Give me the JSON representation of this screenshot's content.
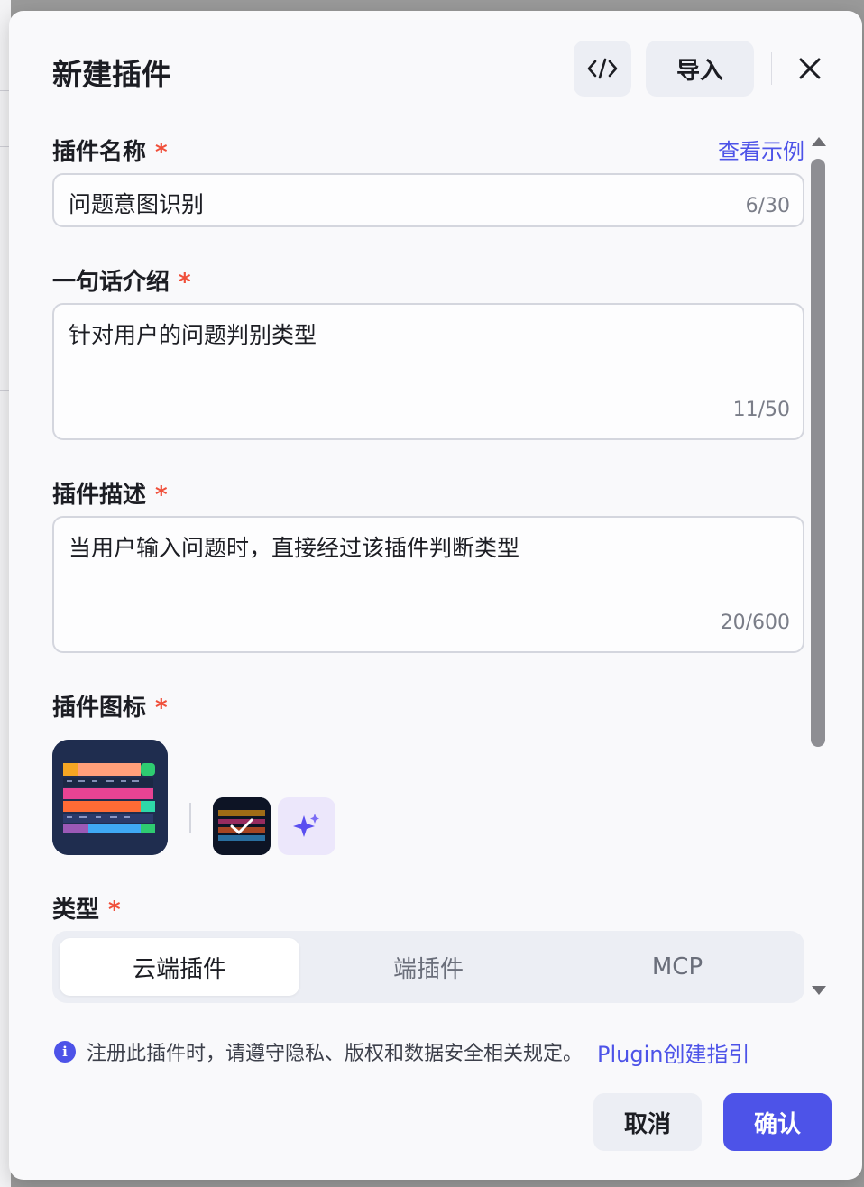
{
  "modal": {
    "title": "新建插件",
    "code_icon": "code-icon",
    "import_label": "导入",
    "close_icon": "close-icon"
  },
  "form": {
    "name": {
      "label": "插件名称",
      "required_mark": "*",
      "example_link": "查看示例",
      "value": "问题意图识别",
      "count": "6/30"
    },
    "intro": {
      "label": "一句话介绍",
      "required_mark": "*",
      "value": "针对用户的问题判别类型",
      "count": "11/50"
    },
    "description": {
      "label": "插件描述",
      "required_mark": "*",
      "value": "当用户输入问题时，直接经过该插件判断类型",
      "count": "20/600"
    },
    "icon": {
      "label": "插件图标",
      "required_mark": "*",
      "ai_generate_icon": "sparkle-icon",
      "selected_icon": "check-icon"
    },
    "type": {
      "label": "类型",
      "required_mark": "*",
      "options": [
        "云端插件",
        "端插件",
        "MCP"
      ],
      "selected": "云端插件"
    }
  },
  "footer": {
    "notice": "注册此插件时，请遵守隐私、版权和数据安全相关规定。",
    "guide_link": "Plugin创建指引",
    "cancel_label": "取消",
    "confirm_label": "确认"
  },
  "colors": {
    "primary": "#4d53e8",
    "required": "#f04f3a",
    "text": "#1c1d23",
    "muted": "#7a7d88",
    "surface": "#eceef4"
  }
}
